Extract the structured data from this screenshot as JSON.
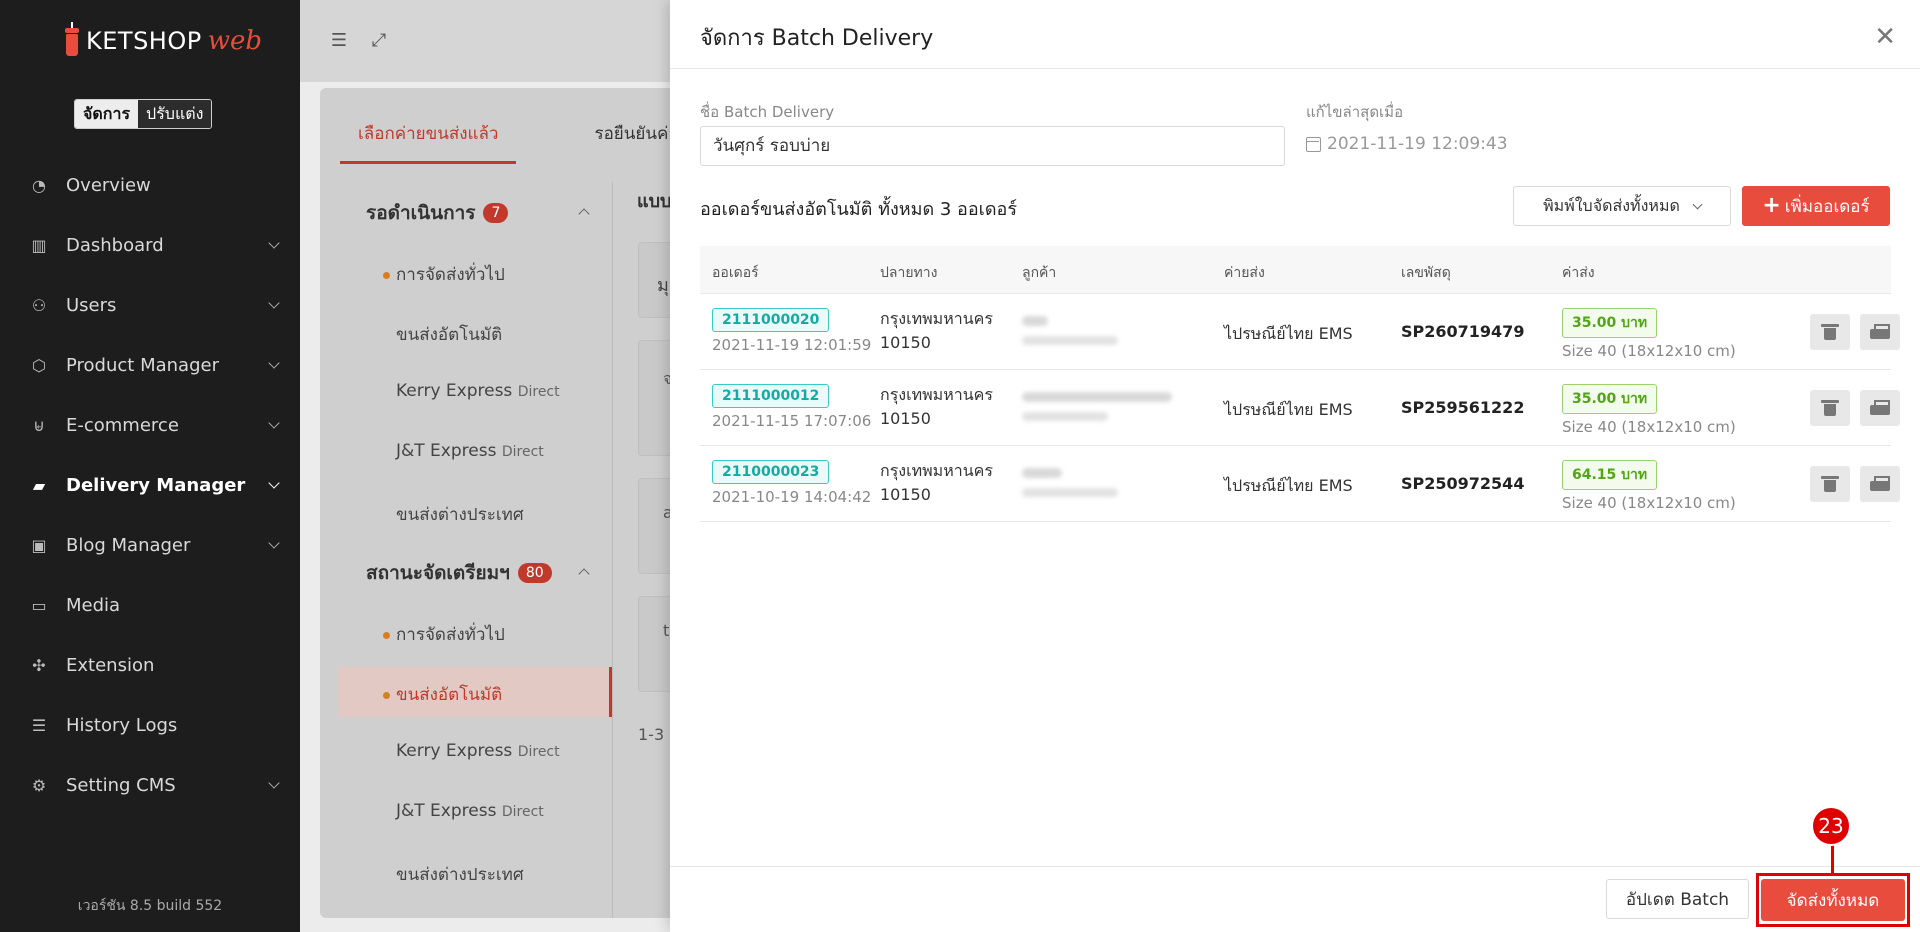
{
  "brand": {
    "name": "KETSHOP",
    "suffix": "web"
  },
  "mode_toggle": {
    "manage": "จัดการ",
    "customize": "ปรับแต่ง"
  },
  "sidebar": {
    "items": [
      {
        "label": "Overview",
        "icon": "chart-pie-icon"
      },
      {
        "label": "Dashboard",
        "icon": "bar-chart-icon"
      },
      {
        "label": "Users",
        "icon": "user-icon"
      },
      {
        "label": "Product Manager",
        "icon": "box-icon"
      },
      {
        "label": "E-commerce",
        "icon": "cart-icon"
      },
      {
        "label": "Delivery Manager",
        "icon": "truck-icon"
      },
      {
        "label": "Blog Manager",
        "icon": "blog-icon"
      },
      {
        "label": "Media",
        "icon": "folder-icon"
      },
      {
        "label": "Extension",
        "icon": "puzzle-icon"
      },
      {
        "label": "History Logs",
        "icon": "list-icon"
      },
      {
        "label": "Setting CMS",
        "icon": "gear-icon"
      }
    ],
    "version": "เวอร์ชัน 8.5 build 552"
  },
  "bg": {
    "tabs": [
      "เลือกค่ายขนส่งแล้ว",
      "รอยืนยันค่าย"
    ],
    "section1": {
      "title": "รอดำเนินการ",
      "count": "7"
    },
    "section2": {
      "title": "สถานะจัดเตรียมฯ",
      "count": "80"
    },
    "subs": {
      "general": "การจัดส่งทั่วไป",
      "auto": "ขนส่งอัตโนมัติ",
      "kerry": "Kerry Express",
      "jt": "J&T Express",
      "direct": "Direct",
      "intl": "ขนส่งต่างประเทศ"
    },
    "pager": "1-3 ",
    "header_fragment": "แบบ",
    "frag1": "มุ",
    "frag2": "จ",
    "frag3": "a",
    "frag4": "t"
  },
  "modal": {
    "title": "จัดการ Batch Delivery",
    "name_label": "ชื่อ Batch Delivery",
    "name_value": "วันศุกร์ รอบบ่าย",
    "updated_label": "แก้ไขล่าสุดเมื่อ",
    "updated_value": "2021-11-19 12:09:43",
    "count_text": "ออเดอร์ขนส่งอัตโนมัติ ทั้งหมด 3 ออเดอร์",
    "print_all": "พิมพ์ใบจัดส่งทั้งหมด",
    "add_order": "เพิ่มออเดอร์",
    "columns": [
      "ออเดอร์",
      "ปลายทาง",
      "ลูกค้า",
      "ค่ายส่ง",
      "เลขพัสดุ",
      "ค่าส่ง"
    ],
    "rows": [
      {
        "order": "2111000020",
        "date": "2021-11-19 12:01:59",
        "province": "กรุงเทพมหานคร",
        "zip": "10150",
        "carrier": "ไปรษณีย์ไทย EMS",
        "tracking": "SP260719479",
        "fee": "35.00 บาท",
        "size": "Size 40 (18x12x10 cm)"
      },
      {
        "order": "2111000012",
        "date": "2021-11-15 17:07:06",
        "province": "กรุงเทพมหานคร",
        "zip": "10150",
        "carrier": "ไปรษณีย์ไทย EMS",
        "tracking": "SP259561222",
        "fee": "35.00 บาท",
        "size": "Size 40 (18x12x10 cm)"
      },
      {
        "order": "2110000023",
        "date": "2021-10-19 14:04:42",
        "province": "กรุงเทพมหานคร",
        "zip": "10150",
        "carrier": "ไปรษณีย์ไทย EMS",
        "tracking": "SP250972544",
        "fee": "64.15 บาท",
        "size": "Size 40 (18x12x10 cm)"
      }
    ],
    "update_batch": "อัปเดต Batch",
    "ship_all": "จัดส่งทั้งหมด"
  },
  "annotation": {
    "step": "23",
    "color": "#e00000"
  },
  "colors": {
    "accent": "#e84c3d",
    "sidebar": "#1d1d1d",
    "order_tag": "#17aaa5",
    "fee_tag": "#52a516"
  }
}
